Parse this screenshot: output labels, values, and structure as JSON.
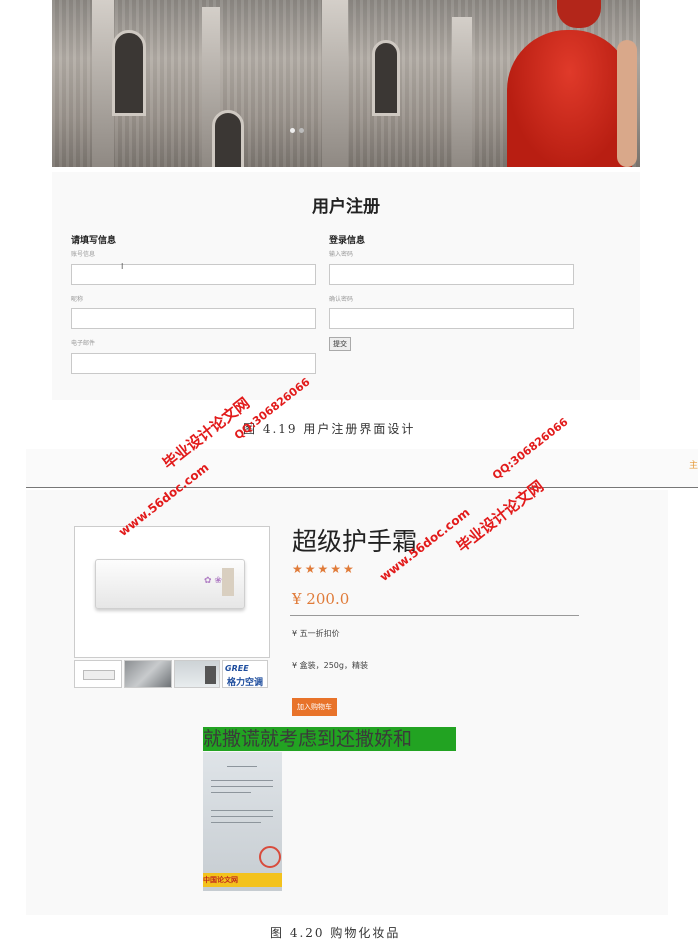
{
  "register": {
    "title": "用户注册",
    "left_heading": "请填写信息",
    "right_heading": "登录信息",
    "account_label": "账号信息",
    "nickname_label": "昵称",
    "email_label": "电子邮件",
    "password_label": "输入密码",
    "confirm_label": "确认密码",
    "submit_label": "提交",
    "cursor_glyph": "I"
  },
  "captions": {
    "fig419": "图 4.19 用户注册界面设计",
    "fig420": "图 4.20 购物化妆品"
  },
  "topbar": {
    "nav_partial": "主"
  },
  "product": {
    "title": "超级护手霜",
    "stars": "★★★★★",
    "price": "¥ 200.0",
    "promo": "¥ 五一折扣价",
    "spec": "¥ 盒装，250g，精装",
    "add_to_cart": "加入购物车",
    "thumb_brand_en": "GREE",
    "thumb_brand_cn": "格力空调",
    "banner_text": "就撒谎就考虑到还撒娇和",
    "doc_logo_text": "中国论文网"
  },
  "watermarks": {
    "site": "www.56doc.com",
    "name": "毕业设计论文网",
    "qq": "QQ:306826066"
  },
  "colors": {
    "accent_orange": "#e07b39",
    "watermark_red": "#e21b1b",
    "banner_green": "#22a322"
  }
}
